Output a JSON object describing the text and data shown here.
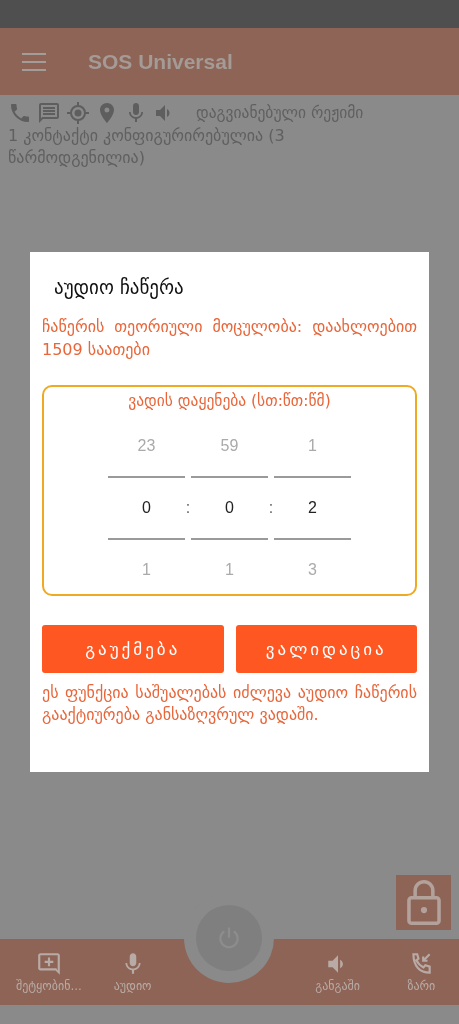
{
  "app_bar": {
    "title": "SOS Universal"
  },
  "status": {
    "mode": "დაგვიანებული რეჟიმი",
    "contacts": "1 კონტაქტი კონფიგურირებულია (3 წარმოდგენილია)"
  },
  "dialog": {
    "title": "აუდიო ჩაწერა",
    "capacity": "ჩაწერის თეორიული მოცულობა: დაახლოებით 1509 საათები",
    "picker": {
      "label": "ვადის დაყენება (სთ:წთ:წმ)",
      "separator": ":",
      "columns": [
        {
          "above": "23",
          "value": "0",
          "below": "1"
        },
        {
          "above": "59",
          "value": "0",
          "below": "1"
        },
        {
          "above": "1",
          "value": "2",
          "below": "3"
        }
      ]
    },
    "buttons": [
      "გაუქმება",
      "ვალიდაცია"
    ],
    "note": "ეს ფუნქცია საშუალებას იძლევა აუდიო ჩაწერის გააქტიურება განსაზღვრულ ვადაში."
  },
  "bottom_nav": [
    {
      "label": "შეტყობინ...",
      "kind": "message"
    },
    {
      "label": "აუდიო",
      "kind": "mic"
    },
    {
      "label": "განგაში",
      "kind": "alarm"
    },
    {
      "label": "ზარი",
      "kind": "call"
    }
  ]
}
